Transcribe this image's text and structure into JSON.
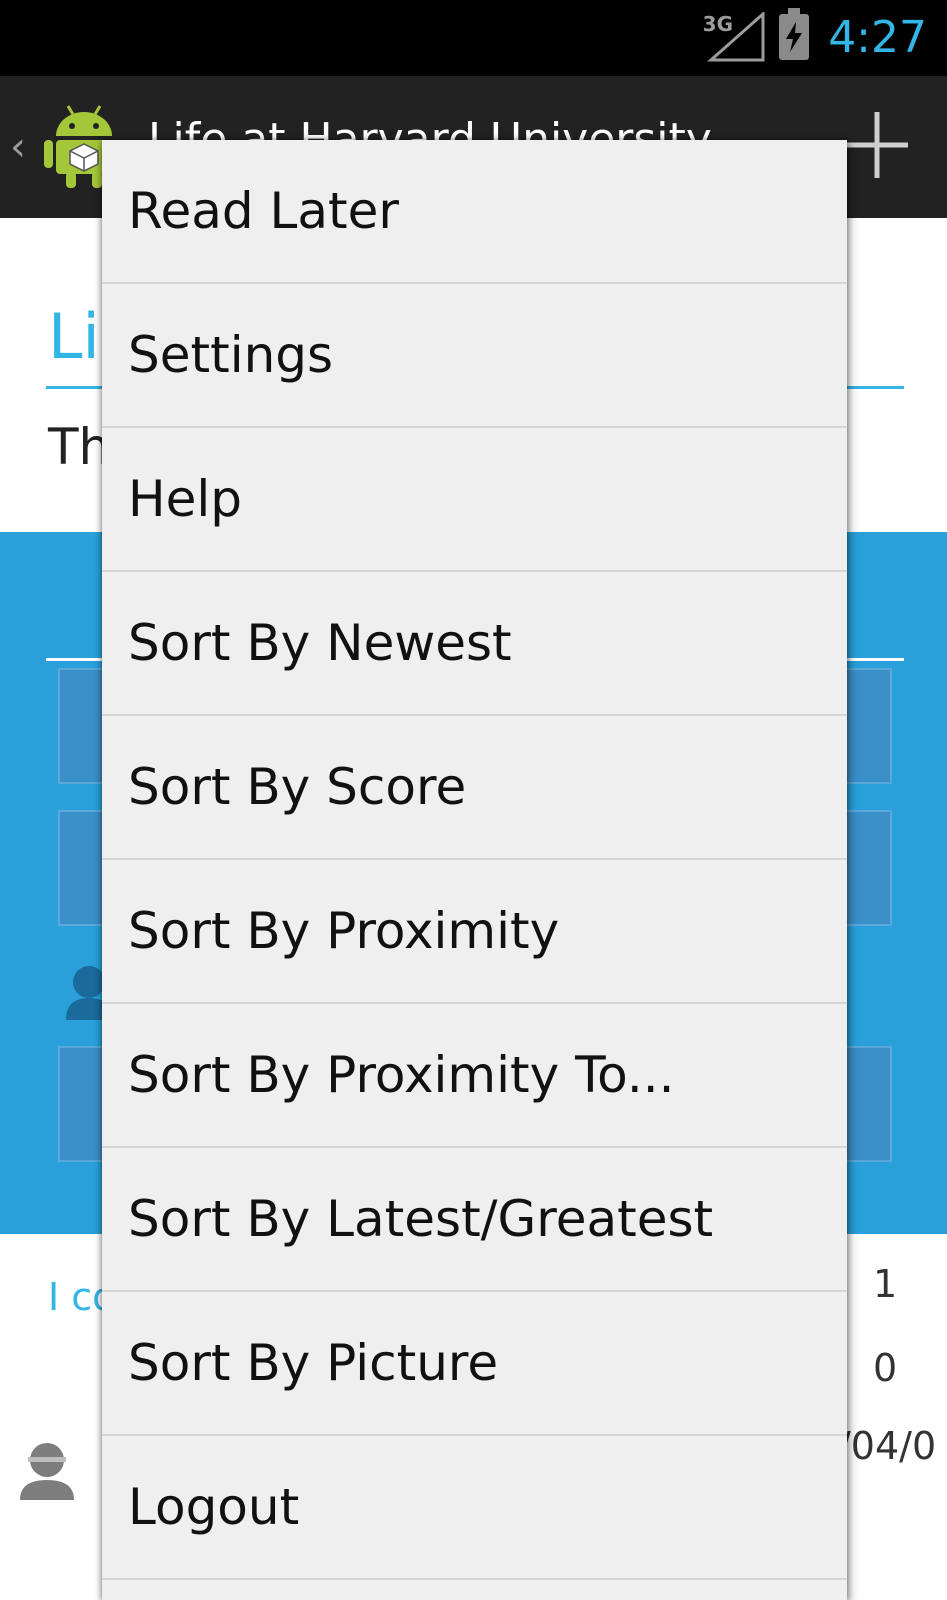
{
  "status_bar": {
    "network": "3G",
    "time": "4:27",
    "clock_color": "#33b5e5"
  },
  "action_bar": {
    "up_caret": "‹",
    "title": "Life at Harvard University",
    "logo_icon": "android-robot-icon",
    "action_icon": "add-icon"
  },
  "background": {
    "heading": "Li",
    "description": "Th",
    "comment_link": "I co",
    "count_1": "1",
    "count_2": "0",
    "date": "/04/0"
  },
  "menu": {
    "items": [
      {
        "label": "Read Later"
      },
      {
        "label": "Settings"
      },
      {
        "label": "Help"
      },
      {
        "label": "Sort By Newest"
      },
      {
        "label": "Sort By Score"
      },
      {
        "label": "Sort By Proximity"
      },
      {
        "label": "Sort By Proximity To..."
      },
      {
        "label": "Sort By Latest/Greatest"
      },
      {
        "label": "Sort By Picture"
      },
      {
        "label": "Logout"
      }
    ]
  },
  "colors": {
    "accent": "#33b5e5",
    "panel": "#29a0da",
    "menu_bg": "#efefef",
    "action_bar": "#222222"
  }
}
